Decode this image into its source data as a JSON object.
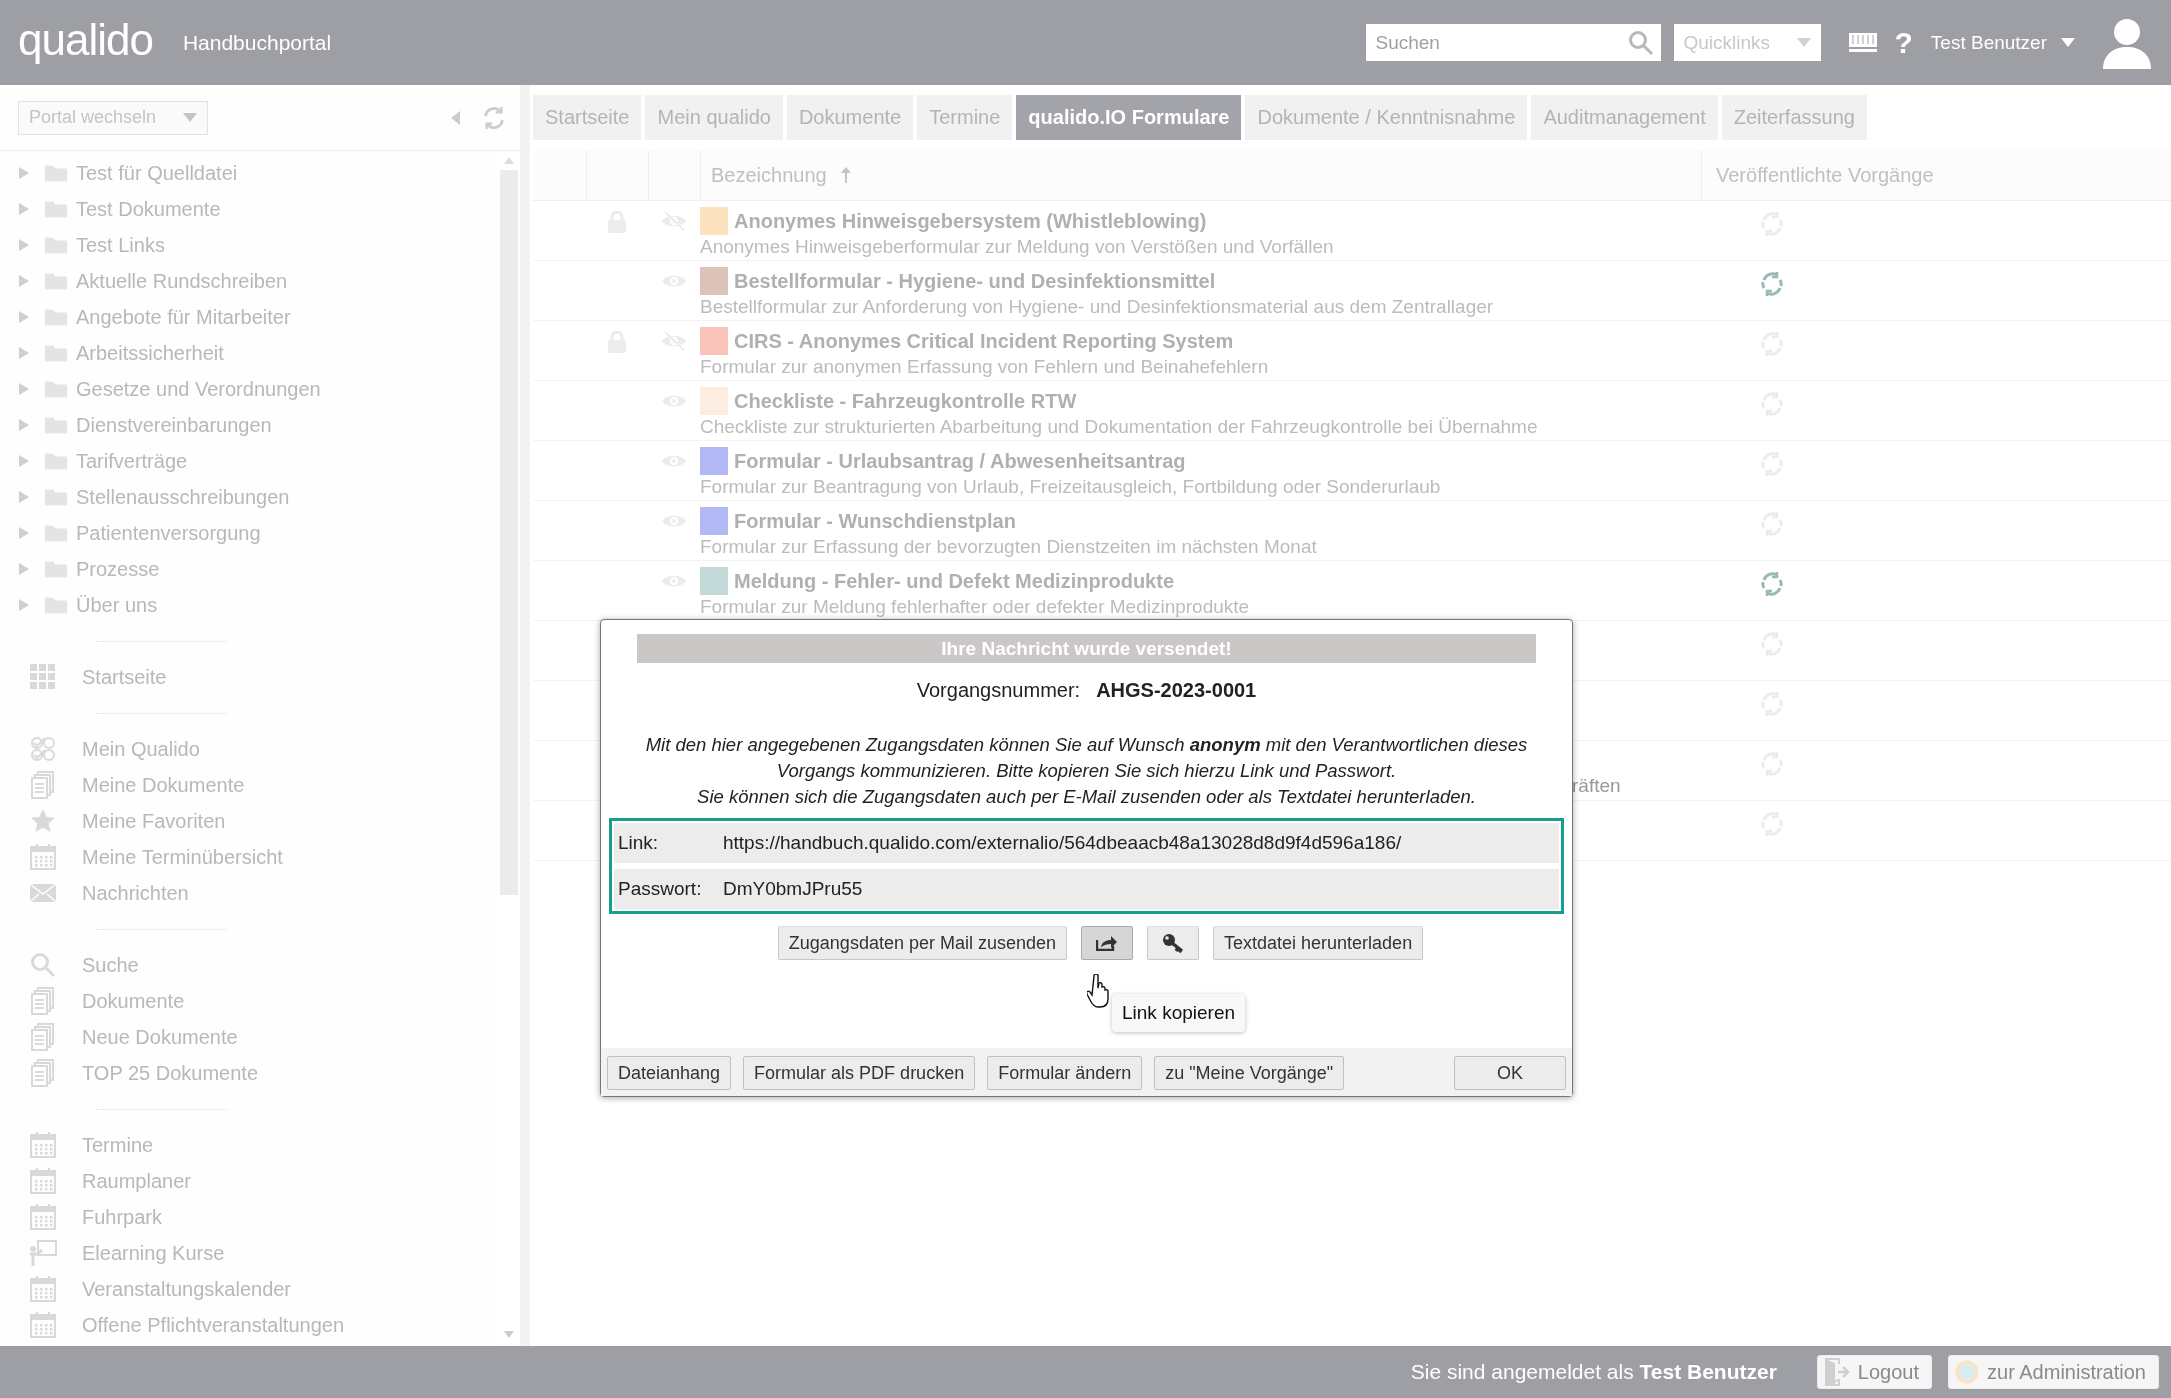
{
  "header": {
    "logo": "qualido",
    "title": "Handbuchportal",
    "search": {
      "placeholder": "Suchen"
    },
    "quicklinks": "Quicklinks",
    "help": "?",
    "user": "Test Benutzer"
  },
  "sidebar": {
    "portal_switch": "Portal wechseln",
    "tree": [
      {
        "label": "Test für Quelldatei",
        "expanded": false
      },
      {
        "label": "Test Dokumente",
        "expanded": false
      },
      {
        "label": "Test Links",
        "expanded": false
      },
      {
        "label": "Aktuelle Rundschreiben",
        "expanded": false
      },
      {
        "label": "Angebote für Mitarbeiter",
        "expanded": false
      },
      {
        "label": "Arbeitssicherheit",
        "expanded": false
      },
      {
        "label": "Gesetze und Verordnungen",
        "expanded": false
      },
      {
        "label": "Dienstvereinbarungen",
        "expanded": false
      },
      {
        "label": "Tarifverträge",
        "expanded": false
      },
      {
        "label": "Stellenausschreibungen",
        "expanded": false
      },
      {
        "label": "Patientenversorgung",
        "expanded": false
      },
      {
        "label": "Prozesse",
        "expanded": false
      },
      {
        "label": "Über uns",
        "expanded": false
      }
    ],
    "menu_groups": [
      [
        {
          "label": "Startseite",
          "kind": "grid"
        }
      ],
      [
        {
          "label": "Mein Qualido",
          "kind": "checks"
        },
        {
          "label": "Meine Dokumente",
          "kind": "documents"
        },
        {
          "label": "Meine Favoriten",
          "kind": "star"
        },
        {
          "label": "Meine Terminübersicht",
          "kind": "calendar"
        },
        {
          "label": "Nachrichten",
          "kind": "mail"
        }
      ],
      [
        {
          "label": "Suche",
          "kind": "search"
        },
        {
          "label": "Dokumente",
          "kind": "documents"
        },
        {
          "label": "Neue Dokumente",
          "kind": "documents"
        },
        {
          "label": "TOP 25 Dokumente",
          "kind": "documents"
        }
      ],
      [
        {
          "label": "Termine",
          "kind": "calendar"
        },
        {
          "label": "Raumplaner",
          "kind": "calendar"
        },
        {
          "label": "Fuhrpark",
          "kind": "calendar"
        },
        {
          "label": "Elearning Kurse",
          "kind": "elearning"
        },
        {
          "label": "Veranstaltungskalender",
          "kind": "calendar"
        },
        {
          "label": "Offene Pflichtveranstaltungen",
          "kind": "calendar"
        }
      ]
    ]
  },
  "tabs": [
    {
      "label": "Startseite",
      "selected": false
    },
    {
      "label": "Mein qualido",
      "selected": false
    },
    {
      "label": "Dokumente",
      "selected": false
    },
    {
      "label": "Termine",
      "selected": false
    },
    {
      "label": "qualido.IO Formulare",
      "selected": true
    },
    {
      "label": "Dokumente / Kenntnisnahme",
      "selected": false
    },
    {
      "label": "Auditmanagement",
      "selected": false
    },
    {
      "label": "Zeiterfassung",
      "selected": false
    }
  ],
  "table": {
    "columns": [
      {
        "label": "Bezeichnung",
        "sorted": true
      },
      {
        "label": "Veröffentlichte Vorgänge",
        "sorted": false
      }
    ],
    "rows": [
      {
        "kind": "form",
        "title": "Anonymes Hinweisgebersystem (Whistleblowing)",
        "description": "Anonymes Hinweisgeberformular zur Meldung von Verstößen und Vorfällen",
        "color": "#fde2bf",
        "locked": true,
        "hidden": true,
        "published": false
      },
      {
        "kind": "form",
        "title": "Bestellformular - Hygiene- und Desinfektionsmittel",
        "description": "Bestellformular zur Anforderung von Hygiene- und Desinfektionsmaterial aus dem Zentrallager",
        "color": "#dcc3b9",
        "locked": false,
        "hidden": false,
        "published": true
      },
      {
        "kind": "form",
        "title": "CIRS - Anonymes Critical Incident Reporting System",
        "description": "Formular zur anonymen Erfassung von Fehlern und Beinahefehlern",
        "color": "#f8c3b9",
        "locked": true,
        "hidden": true,
        "published": false
      },
      {
        "kind": "form",
        "title": "Checkliste - Fahrzeugkontrolle RTW",
        "description": "Checkliste zur strukturierten Abarbeitung und Dokumentation der Fahrzeugkontrolle bei Übernahme",
        "color": "#fdede0",
        "locked": false,
        "hidden": false,
        "published": false
      },
      {
        "kind": "form",
        "title": "Formular - Urlaubsantrag / Abwesenheitsantrag",
        "description": "Formular zur Beantragung von Urlaub, Freizeitausgleich, Fortbildung oder Sonderurlaub",
        "color": "#b3b9f5",
        "locked": false,
        "hidden": false,
        "published": false
      },
      {
        "kind": "form",
        "title": "Formular - Wunschdienstplan",
        "description": "Formular zur Erfassung der bevorzugten Dienstzeiten im nächsten Monat",
        "color": "#b3b9f5",
        "locked": false,
        "hidden": false,
        "published": false
      },
      {
        "kind": "form",
        "title": "Meldung - Fehler- und Defekt Medizinprodukte",
        "description": "Formular zur Meldung fehlerhafter oder defekter Medizinprodukte",
        "color": "#c3d9d7",
        "locked": false,
        "hidden": false,
        "published": true
      },
      {
        "kind": "partial",
        "published": false
      },
      {
        "kind": "partial",
        "published": false
      },
      {
        "kind": "partial",
        "description": "räften",
        "published": false
      },
      {
        "kind": "partial",
        "published": false
      }
    ]
  },
  "dialog": {
    "title": "Ihre Nachricht wurde versendet!",
    "number_label": "Vorgangsnummer:",
    "number": "AHGS-2023-0001",
    "message": "Mit den hier angegebenen Zugangsdaten können Sie auf Wunsch **anonym** mit den Verantwortlichen dieses\nVorgangs kommunizieren. Bitte kopieren Sie sich hierzu Link und Passwort.\nSie können sich die Zugangsdaten auch per E-Mail zusenden oder als Textdatei herunterladen.",
    "credentials": [
      {
        "label": "Link:",
        "value": "https://handbuch.qualido.com/externalio/564dbeaacb48a13028d8d9f4d596a186/"
      },
      {
        "label": "Passwort:",
        "value": "DmY0bmJPru55"
      }
    ],
    "action_buttons": [
      {
        "kind": "text",
        "label": "Zugangsdaten per Mail zusenden",
        "pressed": false
      },
      {
        "kind": "share",
        "pressed": true
      },
      {
        "kind": "key",
        "pressed": false
      },
      {
        "kind": "text",
        "label": "Textdatei herunterladen",
        "pressed": false
      }
    ],
    "tooltip": "Link kopieren",
    "footer_buttons": [
      "Dateianhang",
      "Formular als PDF drucken",
      "Formular ändern",
      "zu \"Meine Vorgänge\""
    ],
    "ok": "OK"
  },
  "footer": {
    "login_text": "Sie sind angemeldet als **Test Benutzer**",
    "logout": "Logout",
    "admin": "zur Administration"
  }
}
